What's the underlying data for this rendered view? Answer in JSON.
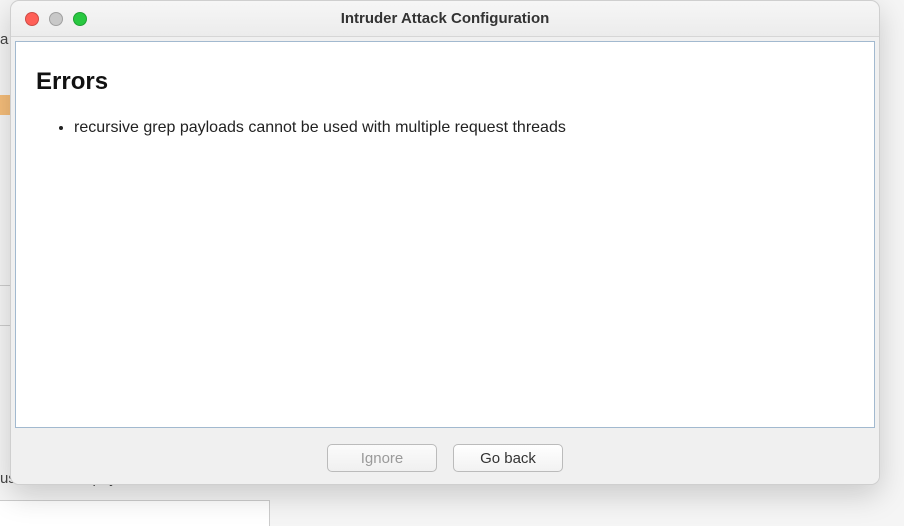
{
  "background": {
    "frag_top": "a",
    "frag_bottom": "usks on each payload before it is used."
  },
  "dialog": {
    "title": "Intruder Attack Configuration",
    "heading": "Errors",
    "errors": [
      "recursive grep payloads cannot be used with multiple request threads"
    ],
    "buttons": {
      "ignore": "Ignore",
      "go_back": "Go back"
    }
  }
}
